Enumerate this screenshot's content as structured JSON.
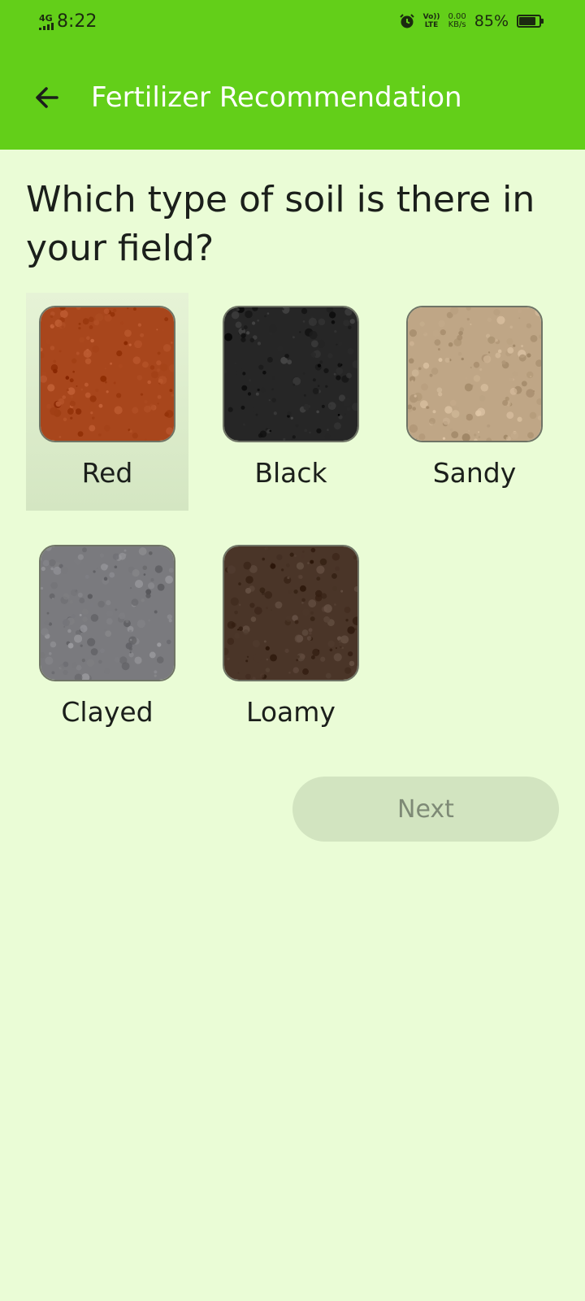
{
  "status_bar": {
    "network": "4G",
    "time": "8:22",
    "volte": "Vo))",
    "lte": "LTE",
    "speed_value": "0.00",
    "speed_unit": "KB/s",
    "battery": "85%",
    "battery_level": 0.85
  },
  "app_bar": {
    "back_icon": "arrow-left-icon",
    "title": "Fertilizer Recommendation"
  },
  "question": "Which type of soil is there in your field?",
  "soil_options": [
    {
      "label": "Red",
      "selected": true,
      "color": "#a8461c"
    },
    {
      "label": "Black",
      "selected": false,
      "color": "#262626"
    },
    {
      "label": "Sandy",
      "selected": false,
      "color": "#bfa686"
    },
    {
      "label": "Clayed",
      "selected": false,
      "color": "#7a7a7e"
    },
    {
      "label": "Loamy",
      "selected": false,
      "color": "#4a3528"
    }
  ],
  "next_button": {
    "label": "Next",
    "enabled": false
  },
  "colors": {
    "app_bar": "#63cf19",
    "background": "#eafcd6",
    "selected_tile": "#dcecca",
    "disabled_button": "#d2e4c0"
  }
}
